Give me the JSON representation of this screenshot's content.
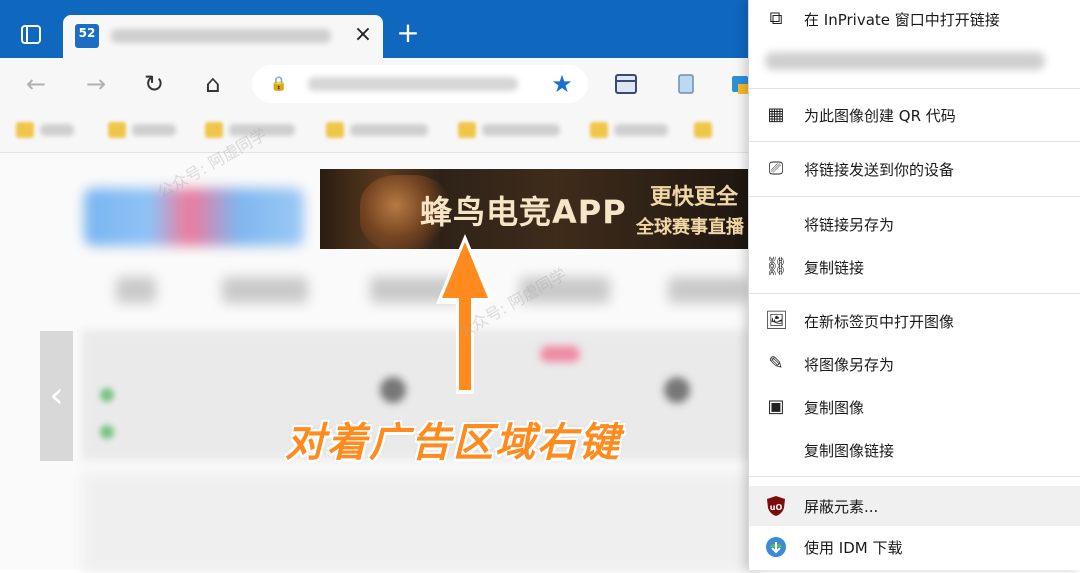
{
  "browser": {
    "tab": {
      "favicon_text": "52",
      "close_glyph": "×"
    },
    "new_tab_glyph": "+",
    "nav": {
      "back_glyph": "←",
      "forward_glyph": "→",
      "refresh_glyph": "↻",
      "home_glyph": "⌂",
      "lock_glyph": "🔒",
      "star_glyph": "★"
    },
    "accent_color": "#0f67be"
  },
  "page": {
    "ad": {
      "title": "蜂鸟电竞APP",
      "sub1": "更快更全",
      "sub2": "全球赛事直播"
    },
    "left_arrow_glyph": "‹"
  },
  "annotation": {
    "text": "对着广告区域右键",
    "color": "#ff8a1d"
  },
  "context_menu": {
    "items": [
      {
        "icon": "inprivate-icon",
        "glyph": "⧉",
        "label": "在 InPrivate 窗口中打开链接"
      },
      {
        "icon": "qr-icon",
        "glyph": "▦",
        "label": "为此图像创建 QR 代码"
      },
      {
        "icon": "send-device-icon",
        "glyph": "⎚",
        "label": "将链接发送到你的设备"
      },
      {
        "icon": "",
        "glyph": "",
        "label": "将链接另存为"
      },
      {
        "icon": "link-icon",
        "glyph": "⛓",
        "label": "复制链接"
      },
      {
        "icon": "open-image-tab-icon",
        "glyph": "🖼",
        "label": "在新标签页中打开图像"
      },
      {
        "icon": "save-image-icon",
        "glyph": "✎",
        "label": "将图像另存为"
      },
      {
        "icon": "copy-image-icon",
        "glyph": "▣",
        "label": "复制图像"
      },
      {
        "icon": "",
        "glyph": "",
        "label": "复制图像链接"
      },
      {
        "icon": "ublock-icon",
        "glyph": "uO",
        "label": "屏蔽元素..."
      },
      {
        "icon": "idm-icon",
        "glyph": "◉",
        "label": "使用 IDM 下载"
      }
    ]
  },
  "watermark": "公众号: 阿虚同学"
}
